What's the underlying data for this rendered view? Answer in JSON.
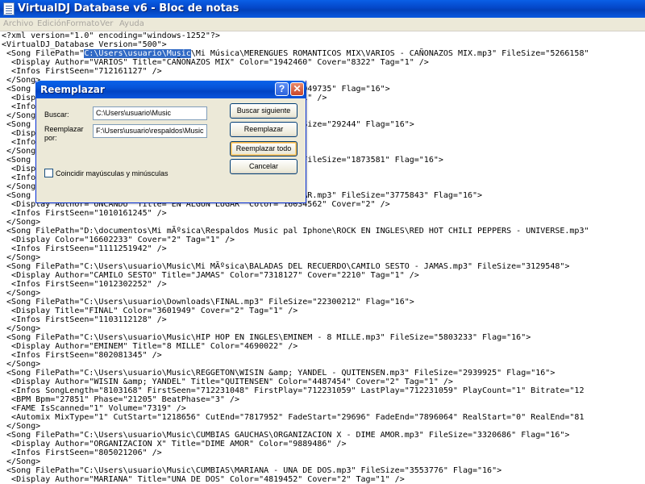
{
  "window": {
    "title": "VirtualDJ Database v6 - Bloc de notas"
  },
  "menu": [
    "Archivo",
    "Edición",
    "Formato",
    "Ver",
    "Ayuda"
  ],
  "selection": {
    "prefix": "<Song FilePath=\"",
    "text": "C:\\Users\\usuario\\Music",
    "suffix": "\\Mi Música\\MERENGUES ROMANTICOS MIX\\VARIOS - CAÑONAZOS MIX.mp3\" FileSize=\"5266158\""
  },
  "lines_before": [
    "<?xml version=\"1.0\" encoding=\"windows-1252\"?>",
    "<VirtualDJ_Database Version=\"500\">"
  ],
  "lines_after": [
    "<Display Author=\"VARIOS\" Title=\"CAÑONAZOS MIX\" Color=\"1942460\" Cover=\"8322\" Tag=\"1\" />",
    "<Infos FirstSeen=\"712161127\" />",
    "</Song>",
    "<Song FilePath=\"...                    0046..mp3\" FileSize=\"4049735\" Flag=\"16\">",
    "<Disp                                  4\" Cover=\"8322\" Tag=\"1\" />",
    "<Info",
    "</Song",
    "<Song                                  ES\\TONO\\JAJA.WAV\" FileSize=\"29244\" Flag=\"16\">",
    "<Disp",
    "<Info",
    "</Song",
    "<Song                                  COS\\SAID - SUCIA.mp3\" FileSize=\"1873581\" Flag=\"16\">",
    "<Disp",
    "<Info",
    "</Song",
    "<Song                                  UNCANDU - EN ALGUN LUGAR.mp3\" FileSize=\"3775843\" Flag=\"16\">",
    "<Display Author=\"UNCANDU\" Title=\"EN ALGUN LUGAR\" Color=\"16034562\" Cover=\"2\" />",
    "<Infos FirstSeen=\"1010161245\" />",
    "</Song>",
    "<Song FilePath=\"D:\\documentos\\Mi mÃºsica\\Respaldos Music pal Iphone\\ROCK EN INGLES\\RED HOT CHILI PEPPERS - UNIVERSE.mp3\"",
    "<Display Color=\"16602233\" Cover=\"2\" Tag=\"1\" />",
    "<Infos FirstSeen=\"1111251942\" />",
    "</Song>",
    "<Song FilePath=\"C:\\Users\\usuario\\Music\\Mi MÃºsica\\BALADAS DEL RECUERDO\\CAMILO SESTO - JAMAS.mp3\" FileSize=\"3129548\">",
    "<Display Author=\"CAMILO SESTO\" Title=\"JAMAS\" Color=\"7318127\" Cover=\"2210\" Tag=\"1\" />",
    "<Infos FirstSeen=\"1012302252\" />",
    "</Song>",
    "<Song FilePath=\"C:\\Users\\usuario\\Downloads\\FINAL.mp3\" FileSize=\"22300212\" Flag=\"16\">",
    "<Display Title=\"FINAL\" Color=\"3601949\" Cover=\"2\" Tag=\"1\" />",
    "<Infos FirstSeen=\"1103112128\" />",
    "</Song>",
    "<Song FilePath=\"C:\\Users\\usuario\\Music\\HIP HOP EN INGLES\\EMINEM - 8 MILLE.mp3\" FileSize=\"5803233\" Flag=\"16\">",
    "<Display Author=\"EMINEM\" Title=\"8 MILLE\" Color=\"4690022\" />",
    "<Infos FirstSeen=\"802081345\" />",
    "</Song>",
    "<Song FilePath=\"C:\\Users\\usuario\\Music\\REGGETON\\WISIN &amp; YANDEL - QUITENSEN.mp3\" FileSize=\"2939925\" Flag=\"16\">",
    "<Display Author=\"WISIN &amp; YANDEL\" Title=\"QUITENSEN\" Color=\"4487454\" Cover=\"2\" Tag=\"1\" />",
    "<Infos SongLength=\"8103168\" FirstSeen=\"712231048\" FirstPlay=\"712231059\" LastPlay=\"712231059\" PlayCount=\"1\" Bitrate=\"12",
    "<BPM Bpm=\"27851\" Phase=\"21205\" BeatPhase=\"3\" />",
    "<FAME IsScanned=\"1\" Volume=\"7319\" />",
    "<Automix MixType=\"1\" CutStart=\"1218656\" CutEnd=\"7817952\" FadeStart=\"29696\" FadeEnd=\"7896064\" RealStart=\"0\" RealEnd=\"81",
    "</Song>",
    "<Song FilePath=\"C:\\Users\\usuario\\Music\\CUMBIAS GAUCHAS\\ORGANIZACION X - DIME AMOR.mp3\" FileSize=\"3320686\" Flag=\"16\">",
    "<Display Author=\"ORGANIZACION X\" Title=\"DIME AMOR\" Color=\"9889486\" />",
    "<Infos FirstSeen=\"805021206\" />",
    "</Song>",
    "<Song FilePath=\"C:\\Users\\usuario\\Music\\CUMBIAS\\MARIANA - UNA DE DOS.mp3\" FileSize=\"3553776\" Flag=\"16\">",
    "<Display Author=\"MARIANA\" Title=\"UNA DE DOS\" Color=\"4819452\" Cover=\"2\" Tag=\"1\" />"
  ],
  "dialog": {
    "title": "Reemplazar",
    "help_glyph": "?",
    "close_glyph": "✕",
    "find_label": "Buscar:",
    "find_value": "C:\\Users\\usuario\\Music",
    "replace_label": "Reemplazar por:",
    "replace_value": "F:\\Users\\usuario\\respaldos\\Music",
    "match_case_label": "Coincidir mayúsculas y minúsculas",
    "btn_find_next": "Buscar siguiente",
    "btn_replace": "Reemplazar",
    "btn_replace_all": "Reemplazar todo",
    "btn_cancel": "Cancelar"
  }
}
